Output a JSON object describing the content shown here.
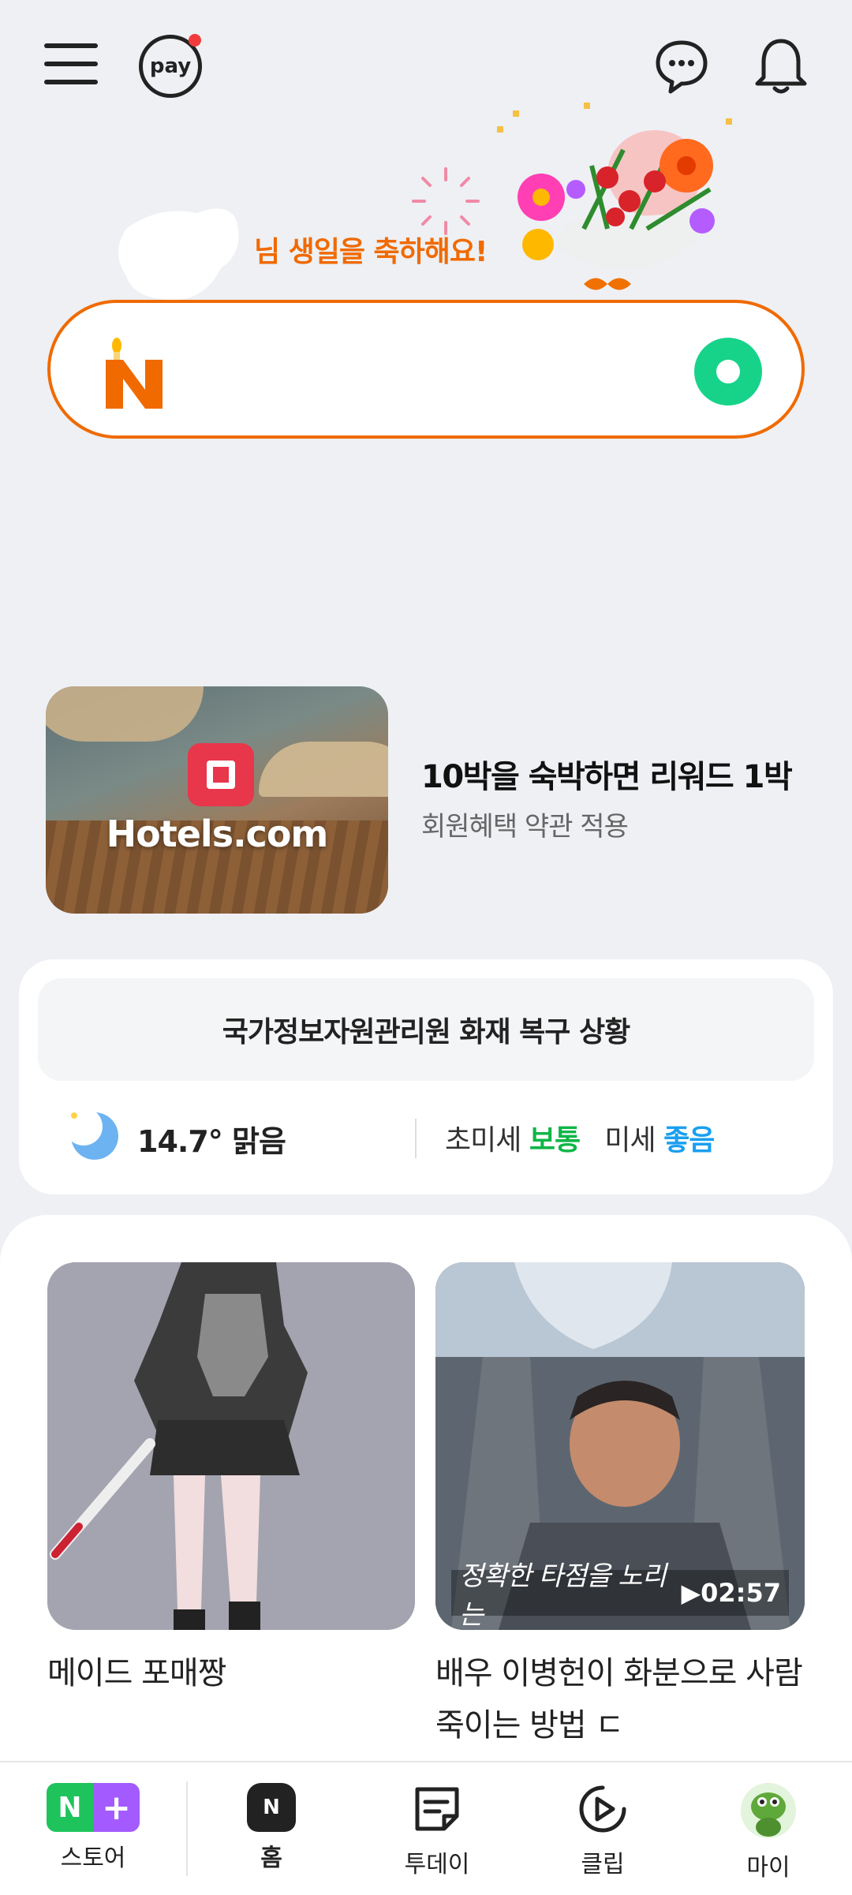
{
  "header": {
    "pay_label": "pay"
  },
  "birthday": {
    "message": "님 생일을 축하해요!"
  },
  "search": {
    "logo_letter": "N",
    "placeholder": ""
  },
  "ad": {
    "brand": "Hotels.com",
    "title": "10박을 숙박하면 리워드 1박",
    "subtitle": "회원혜택 약관 적용"
  },
  "info": {
    "news_banner": "국가정보자원관리원 화재 복구 상황",
    "temperature": "14.7°",
    "condition": "맑음",
    "fine_dust_label": "초미세",
    "fine_dust_status": "보통",
    "dust_label": "미세",
    "dust_status": "좋음"
  },
  "feed": {
    "items": [
      {
        "caption": "메이드 포매짱"
      },
      {
        "caption": "배우 이병헌이 화분으로 사람 죽이는 방법 ㄷ",
        "subtitle_overlay": "정확한 타점을 노리는",
        "duration": "▶02:57"
      }
    ]
  },
  "bottom_nav": {
    "items": [
      {
        "label": "스토어",
        "icon": "store-icon"
      },
      {
        "label": "홈",
        "icon": "home-icon"
      },
      {
        "label": "투데이",
        "icon": "today-icon"
      },
      {
        "label": "클립",
        "icon": "clip-icon"
      },
      {
        "label": "마이",
        "icon": "avatar"
      }
    ]
  },
  "colors": {
    "accent_orange": "#f06a00",
    "naver_green": "#17d38a",
    "status_normal": "#0fb548",
    "status_good": "#1a9ff0"
  }
}
